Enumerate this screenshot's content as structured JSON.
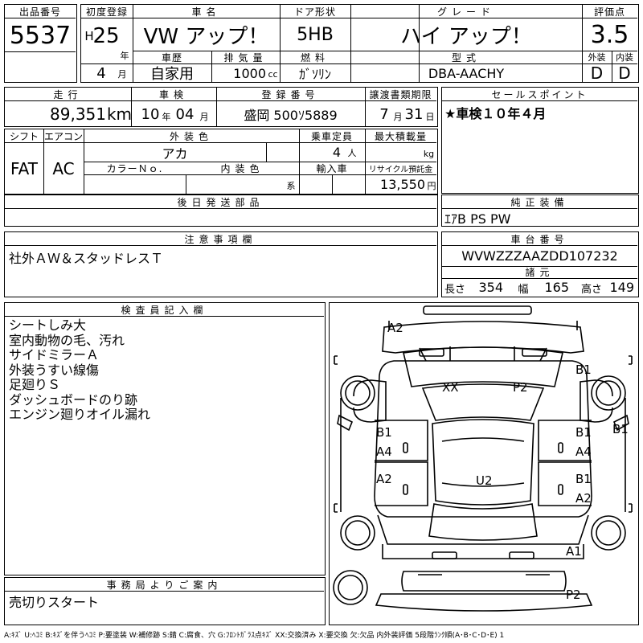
{
  "lot": {
    "label": "出品番号",
    "value": "5537"
  },
  "first_reg": {
    "label": "初度登録",
    "era": "H",
    "year": "25",
    "year_unit": "年",
    "month": "4",
    "month_unit": "月"
  },
  "car_name": {
    "label": "車名",
    "value": "VW アップ！"
  },
  "door": {
    "label": "ドア形状",
    "value": "5HB"
  },
  "grade": {
    "label": "グレード",
    "value": "ハイ アップ！"
  },
  "score": {
    "label": "評価点",
    "value": "3.5"
  },
  "history": {
    "label": "車歴",
    "value": "自家用"
  },
  "displacement": {
    "label": "排気量",
    "value": "1000",
    "unit": "cc"
  },
  "fuel": {
    "label": "燃料",
    "value": "ｶﾞｿﾘﾝ"
  },
  "model": {
    "label": "型式",
    "value": "DBA-AACHY"
  },
  "exterior_grade": {
    "label": "外装",
    "value": "D"
  },
  "interior_grade": {
    "label": "内装",
    "value": "D"
  },
  "mileage": {
    "label": "走行",
    "value": "89,351",
    "unit": "km"
  },
  "inspection": {
    "label": "車検",
    "year": "10",
    "year_unit": "年",
    "month": "04",
    "month_unit": "月"
  },
  "reg_no": {
    "label": "登録番号",
    "value": "盛岡 500ｿ5889"
  },
  "transfer": {
    "label": "譲渡書類期限",
    "month": "7",
    "month_unit": "月",
    "day": "31",
    "day_unit": "日"
  },
  "sales_point": {
    "label": "セールスポイント",
    "value": "★車検１０年４月"
  },
  "shift": {
    "label": "シフト",
    "value": "FAT"
  },
  "aircon": {
    "label": "エアコン",
    "value": "AC"
  },
  "ext_color": {
    "label": "外装色",
    "value": "アカ"
  },
  "capacity": {
    "label": "乗車定員",
    "value": "4",
    "unit": "人"
  },
  "max_load": {
    "label": "最大積載量",
    "value": "",
    "unit": "kg"
  },
  "color_no": {
    "label": "カラーＮｏ.",
    "value": ""
  },
  "int_color": {
    "label": "内装色",
    "value": "",
    "unit": "系"
  },
  "import": {
    "label": "輸入車",
    "value": ""
  },
  "recycle": {
    "label": "リサイクル預託金",
    "value": "13,550",
    "unit": "円"
  },
  "later_parts": {
    "label": "後日発送部品",
    "value": ""
  },
  "equipment": {
    "label": "純正装備",
    "value": "ｴｱB PS PW"
  },
  "notes": {
    "label": "注意事項欄",
    "value": "社外ＡＷ＆スタッドレスＴ"
  },
  "chassis": {
    "label": "車台番号",
    "value": "WVWZZZAAZDD107232"
  },
  "specs": {
    "label": "諸元",
    "length_label": "長さ",
    "length": "354",
    "width_label": "幅",
    "width": "165",
    "height_label": "高さ",
    "height": "149"
  },
  "inspector": {
    "label": "検査員記入欄",
    "lines": [
      "シートしみ大",
      "室内動物の毛、汚れ",
      "サイドミラーＡ",
      "外装うすい線傷",
      "足廻りＳ",
      "ダッシュボードのり跡",
      "エンジン廻りオイル漏れ"
    ]
  },
  "office": {
    "label": "事務局よりご案内",
    "value": "売切りスタート"
  },
  "diagram_marks": {
    "front": "A2",
    "windshield_left": "XX",
    "windshield_right": "P2",
    "right_fender": "B1",
    "right_side_outer": "B1",
    "left_front_door": [
      "B1",
      "A4"
    ],
    "right_front_door": [
      "B1",
      "A4"
    ],
    "left_rear_door": "A2",
    "right_rear_door": [
      "B1",
      "A2"
    ],
    "roof": "U2",
    "right_rear_quarter": "A1",
    "rear": "P2"
  },
  "legend": "A:ｷｽﾞ U:ﾍｺﾐ B:ｷｽﾞを伴うﾍｺﾐ P:要塗装 W:補修跡 S:錆 C:腐食、穴 G:ﾌﾛﾝﾄｶﾞﾗｽ点ｷｽﾞ XX:交換済み X:要交換 欠:欠品 内外装評価 5段階ﾗﾝｸ順(A･B･C･D･E) 1"
}
